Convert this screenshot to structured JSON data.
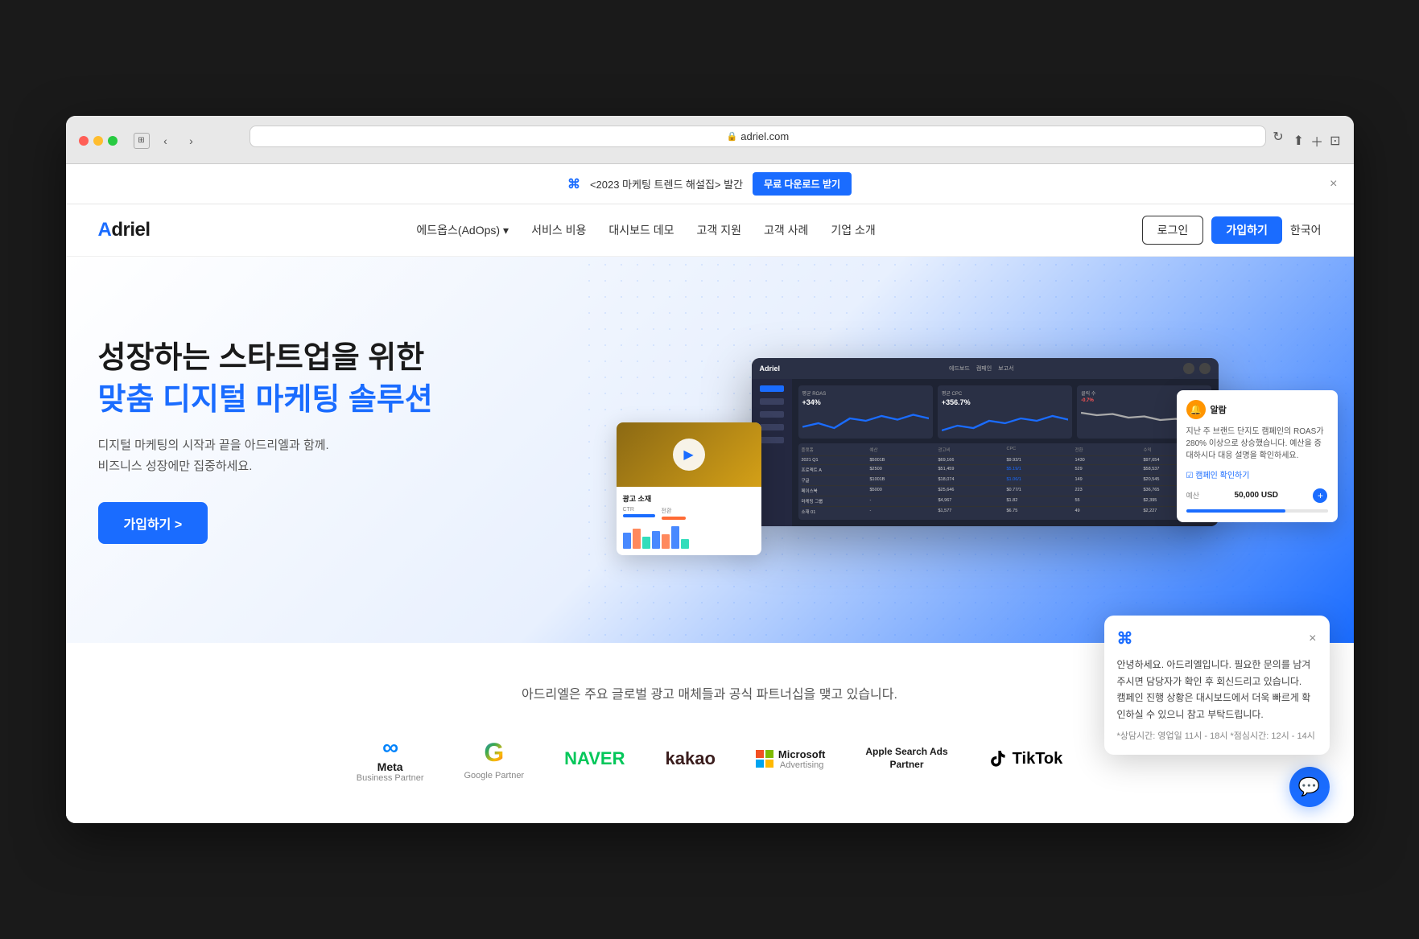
{
  "browser": {
    "url": "adriel.com",
    "url_display": "🔒 adriel.com"
  },
  "announcement": {
    "logo": "⌘",
    "text": "<2023 마케팅 트렌드 해설집> 발간",
    "button_label": "무료 다운로드 받기",
    "close_label": "×"
  },
  "nav": {
    "logo": "Adriel",
    "links": [
      {
        "label": "에드옵스(AdOps)",
        "has_dropdown": true
      },
      {
        "label": "서비스 비용"
      },
      {
        "label": "대시보드 데모"
      },
      {
        "label": "고객 지원"
      },
      {
        "label": "고객 사례"
      },
      {
        "label": "기업 소개"
      }
    ],
    "login_label": "로그인",
    "signup_label": "가입하기",
    "lang_label": "한국어"
  },
  "hero": {
    "title_line1": "성장하는 스타트업을 위한",
    "title_line2": "맞춤 디지털 마케팅 솔루션",
    "description_line1": "디지털 마케팅의 시작과 끝을 아드리엘과 함께.",
    "description_line2": "비즈니스 성장에만 집중하세요.",
    "cta_label": "가입하기 >"
  },
  "dashboard": {
    "logo": "Adriel",
    "metrics": [
      {
        "label": "평균 ROAS",
        "value": "+34%",
        "change": "positive"
      },
      {
        "label": "평균 CPC",
        "value": "+356.7%",
        "change": "positive"
      },
      {
        "label": "클릭 수",
        "value": "-0.7%",
        "change": "negative"
      }
    ],
    "table_headers": [
      "플랫폼",
      "예산",
      "광고비",
      "CPC",
      "전환",
      "수익"
    ],
    "table_rows": [
      [
        "2021 Q1",
        "$5001B",
        "$69,166",
        "$9.92/1",
        "1430",
        "$97,654"
      ],
      [
        "프로젝트 A",
        "$2500",
        "$51,459",
        "$5.19/1",
        "529",
        "$58,537"
      ],
      [
        "구글",
        "$1001B",
        "$18,074",
        "$1.06/1",
        "149",
        "$20,545"
      ],
      [
        "페이스북",
        "$5000",
        "$25,646",
        "$0.77/1",
        "223",
        "$36,765"
      ],
      [
        "마케팅 그룹",
        "-",
        "$4,967",
        "$1.82",
        "55",
        "$2,395"
      ],
      [
        "소재 01",
        "-",
        "$1,577",
        "$6.75",
        "49",
        "$2,227"
      ]
    ]
  },
  "ad_card": {
    "title": "광고 소재",
    "play_icon": "▶",
    "metrics": [
      {
        "label": "CTR",
        "value": ""
      },
      {
        "label": "전환",
        "value": ""
      }
    ]
  },
  "alert": {
    "icon": "🔔",
    "title": "알람",
    "body": "지난 주 브랜드 단지도 캠페인의 ROAS가 280% 이상으로 상승했습니다. 예산을 증대하시다 대응 설명을 확인하세요.",
    "link": "☑ 캠페인 확인하기",
    "budget_label": "예산",
    "budget_value": "50,000 USD",
    "add_label": "+"
  },
  "partners": {
    "intro_text": "아드리엘은 주요 글로벌 광고 매체들과 공식 파트너십을 맺고 있습니다.",
    "logos": [
      {
        "name": "Meta",
        "sub": "Business Partner"
      },
      {
        "name": "Google",
        "sub": "Google Partner"
      },
      {
        "name": "NAVER",
        "sub": ""
      },
      {
        "name": "kakao",
        "sub": ""
      },
      {
        "name": "Microsoft",
        "sub": "Advertising"
      },
      {
        "name": "Apple Search Ads",
        "sub": "Partner"
      },
      {
        "name": "TikTok",
        "sub": ""
      }
    ]
  },
  "chat": {
    "logo": "⌘",
    "close_label": "×",
    "greeting": "안녕하세요. 아드리엘입니다. 필요한 문의를 남겨주시면 담당자가 확인 후 회신드리고 있습니다.\n캠페인 진행 상황은 대시보드에서 더욱 빠르게 확인하실 수 있으니 참고 부탁드립니다.",
    "hours": "*상담시간: 영업일 11시 - 18시 *점심시간: 12시 - 14시",
    "bubble_icon": "💬"
  }
}
